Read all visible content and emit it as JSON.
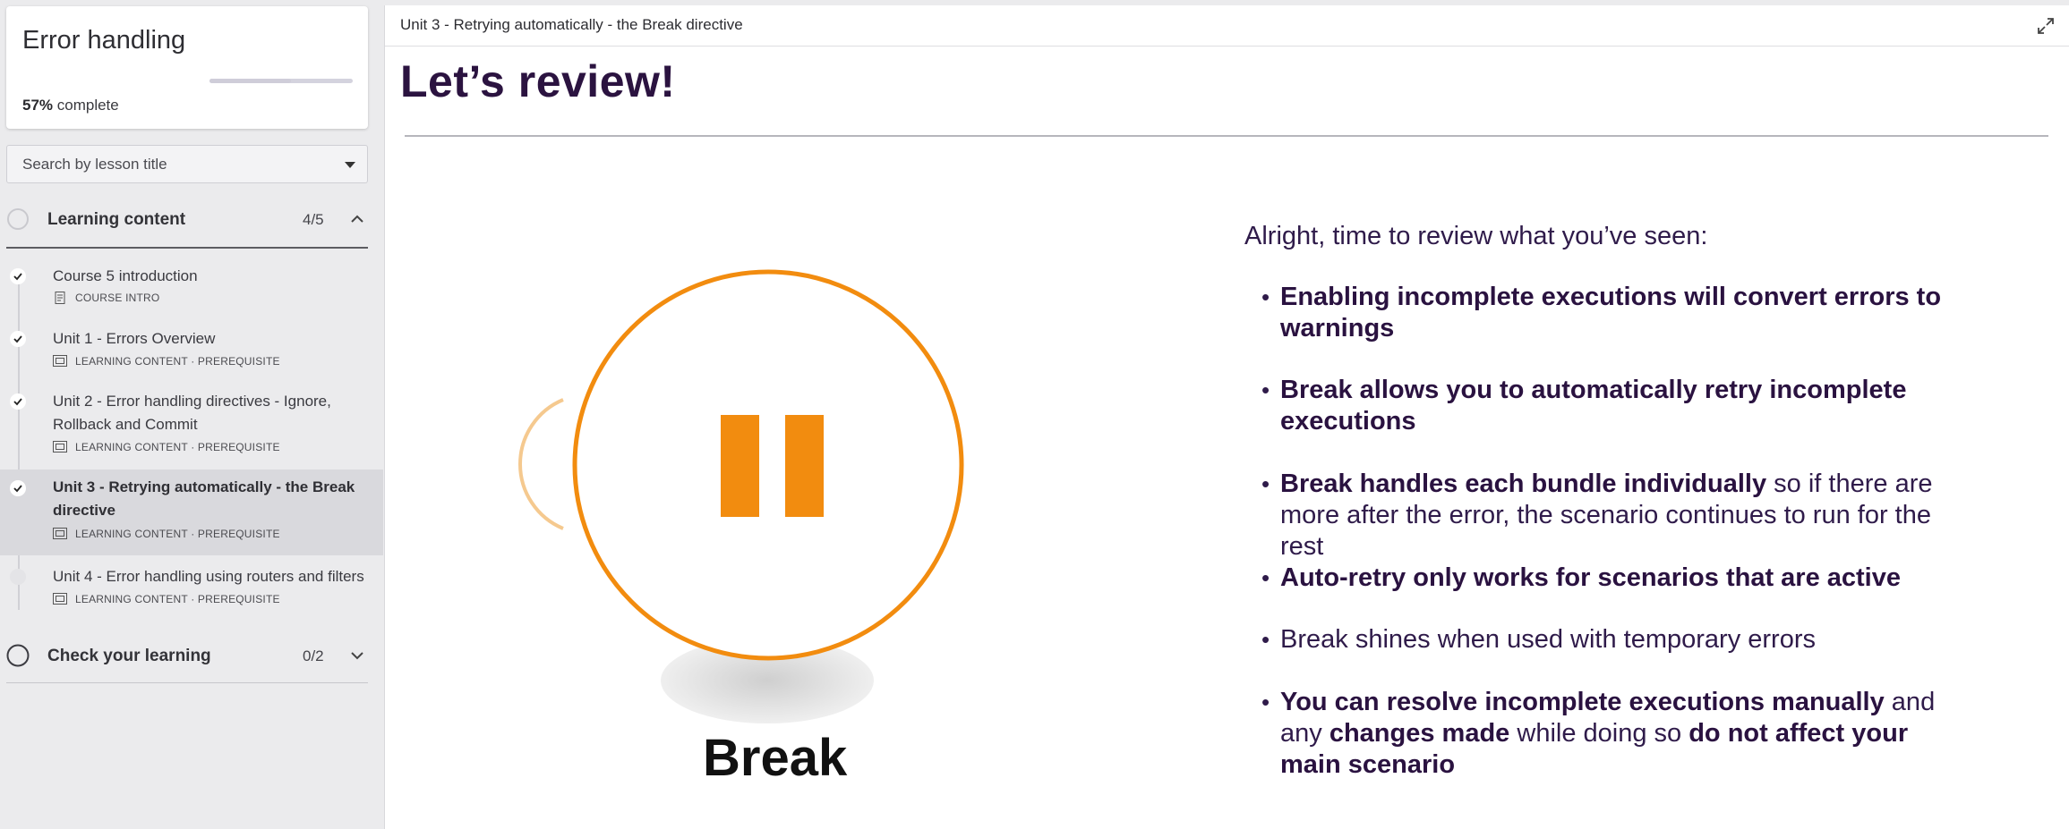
{
  "sidebar": {
    "course_title": "Error handling",
    "progress_percent": "57%",
    "progress_suffix": " complete",
    "progress_value": 0.57,
    "search_placeholder": "Search by lesson title",
    "sections": [
      {
        "title": "Learning content",
        "count": "4/5",
        "expanded": true
      },
      {
        "title": "Check your learning",
        "count": "0/2",
        "expanded": false
      }
    ],
    "lessons": [
      {
        "title": "Course 5 introduction",
        "meta": "COURSE INTRO",
        "icon": "document-icon",
        "completed": true,
        "active": false
      },
      {
        "title": "Unit 1 - Errors Overview",
        "meta": "LEARNING CONTENT · PREREQUISITE",
        "icon": "slides-icon",
        "completed": true,
        "active": false
      },
      {
        "title": "Unit 2 - Error handling directives - Ignore, Rollback and Commit",
        "meta": "LEARNING CONTENT · PREREQUISITE",
        "icon": "slides-icon",
        "completed": true,
        "active": false
      },
      {
        "title": "Unit 3 - Retrying automatically - the Break directive",
        "meta": "LEARNING CONTENT · PREREQUISITE",
        "icon": "slides-icon",
        "completed": true,
        "active": true
      },
      {
        "title": "Unit 4 - Error handling using routers and filters",
        "meta": "LEARNING CONTENT · PREREQUISITE",
        "icon": "slides-icon",
        "completed": false,
        "active": false
      }
    ]
  },
  "main": {
    "topbar_title": "Unit 3 - Retrying automatically - the Break directive",
    "slide_heading": "Let’s review!",
    "graphic_label": "Break",
    "intro": "Alright, time to review what you’ve seen:",
    "bullets": [
      {
        "bold1": "Enabling incomplete executions will convert errors to warnings",
        "rest": "",
        "bold2": "",
        "rest2": "",
        "bold3": "",
        "rest3": ""
      },
      {
        "bold1": "Break allows you to automatically retry incomplete executions",
        "rest": "",
        "bold2": "",
        "rest2": "",
        "bold3": "",
        "rest3": ""
      },
      {
        "bold1": "Break handles each bundle individually",
        "rest": " so if there are more after the error, the scenario continues to run for the rest",
        "bold2": "",
        "rest2": "",
        "bold3": "",
        "rest3": ""
      },
      {
        "bold1": "Auto-retry only works for scenarios that are active",
        "rest": "",
        "bold2": "",
        "rest2": "",
        "bold3": "",
        "rest3": ""
      },
      {
        "bold1": "",
        "rest": "Break shines when used with temporary errors",
        "bold2": "",
        "rest2": "",
        "bold3": "",
        "rest3": ""
      },
      {
        "bold1": "You can resolve incomplete executions manually",
        "rest": " and any ",
        "bold2": "changes made",
        "rest2": " while doing so ",
        "bold3": "do not affect your main scenario",
        "rest3": ""
      }
    ]
  },
  "colors": {
    "accent_orange": "#f28c0f",
    "heading_purple": "#2b1340",
    "text_purple": "#2f1b4a"
  }
}
